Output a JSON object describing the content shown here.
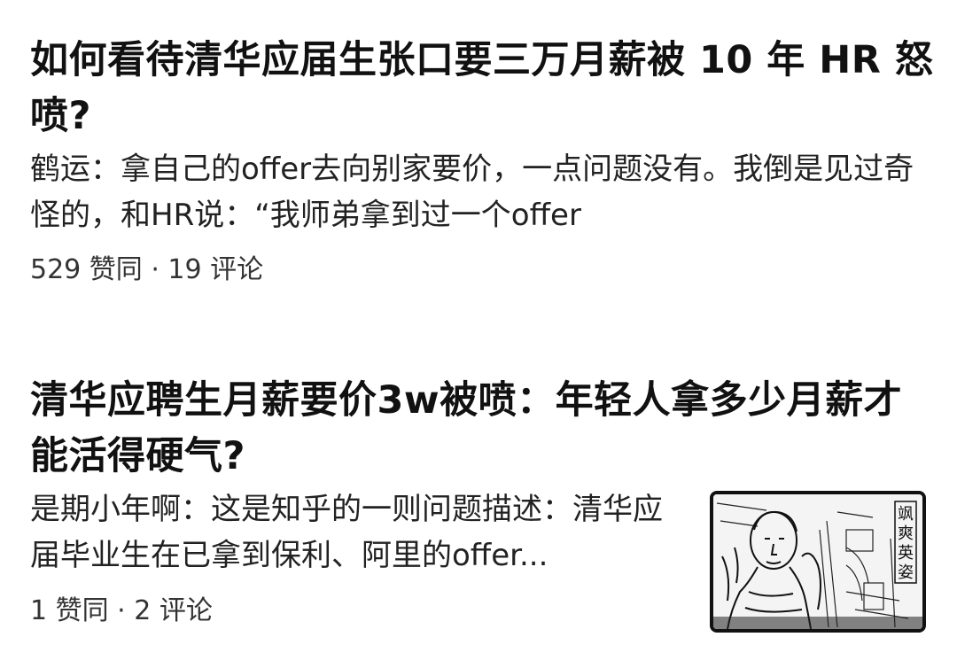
{
  "results": [
    {
      "title": "如何看待清华应届生张口要三万月薪被 10 年 HR 怒喷?",
      "excerpt_author": "鹤运",
      "excerpt_sep": "：",
      "excerpt_text": "拿自己的offer去向别家要价，一点问题没有。我倒是见过奇怪的，和HR说：“我师弟拿到过一个offer",
      "upvotes": "529 赞同",
      "dot": " · ",
      "comments": "19 评论"
    },
    {
      "title": "清华应聘生月薪要价3w被喷：年轻人拿多少月薪才能活得硬气?",
      "excerpt_author": "是期小年啊",
      "excerpt_sep": "：",
      "excerpt_text": "这是知乎的一则问题描述：清华应届毕业生在已拿到保利、阿里的offer...",
      "upvotes": "1 赞同",
      "dot": " · ",
      "comments": "2 评论",
      "thumbnail_caption": "飒爽英姿"
    }
  ]
}
